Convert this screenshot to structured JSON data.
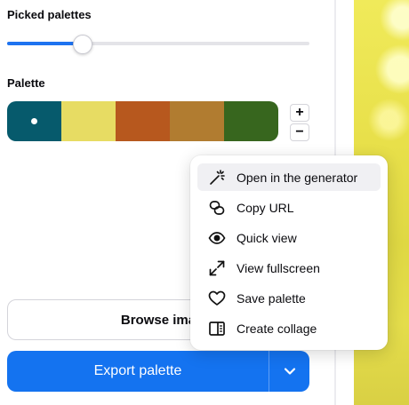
{
  "panel": {
    "picked_title": "Picked palettes",
    "slider_value_fraction": 0.25,
    "palette_title": "Palette",
    "palette_colors": [
      "#065a6c",
      "#e7dc63",
      "#b7581e",
      "#b17c30",
      "#37661e"
    ],
    "selected_swatch_index": 0,
    "add_label": "+",
    "remove_label": "−"
  },
  "buttons": {
    "browse_label": "Browse ima",
    "export_label": "Export palette",
    "dropdown_icon": "chevron-down-icon"
  },
  "menu": {
    "items": [
      {
        "label": "Open in the generator",
        "icon": "magic-wand-icon"
      },
      {
        "label": "Copy URL",
        "icon": "link-icon"
      },
      {
        "label": "Quick view",
        "icon": "eye-icon"
      },
      {
        "label": "View fullscreen",
        "icon": "expand-icon"
      },
      {
        "label": "Save palette",
        "icon": "heart-icon"
      },
      {
        "label": "Create collage",
        "icon": "collage-icon"
      }
    ],
    "active_index": 0
  },
  "colors": {
    "accent": "#1473f0",
    "slider_fill": "#1e73f0"
  }
}
